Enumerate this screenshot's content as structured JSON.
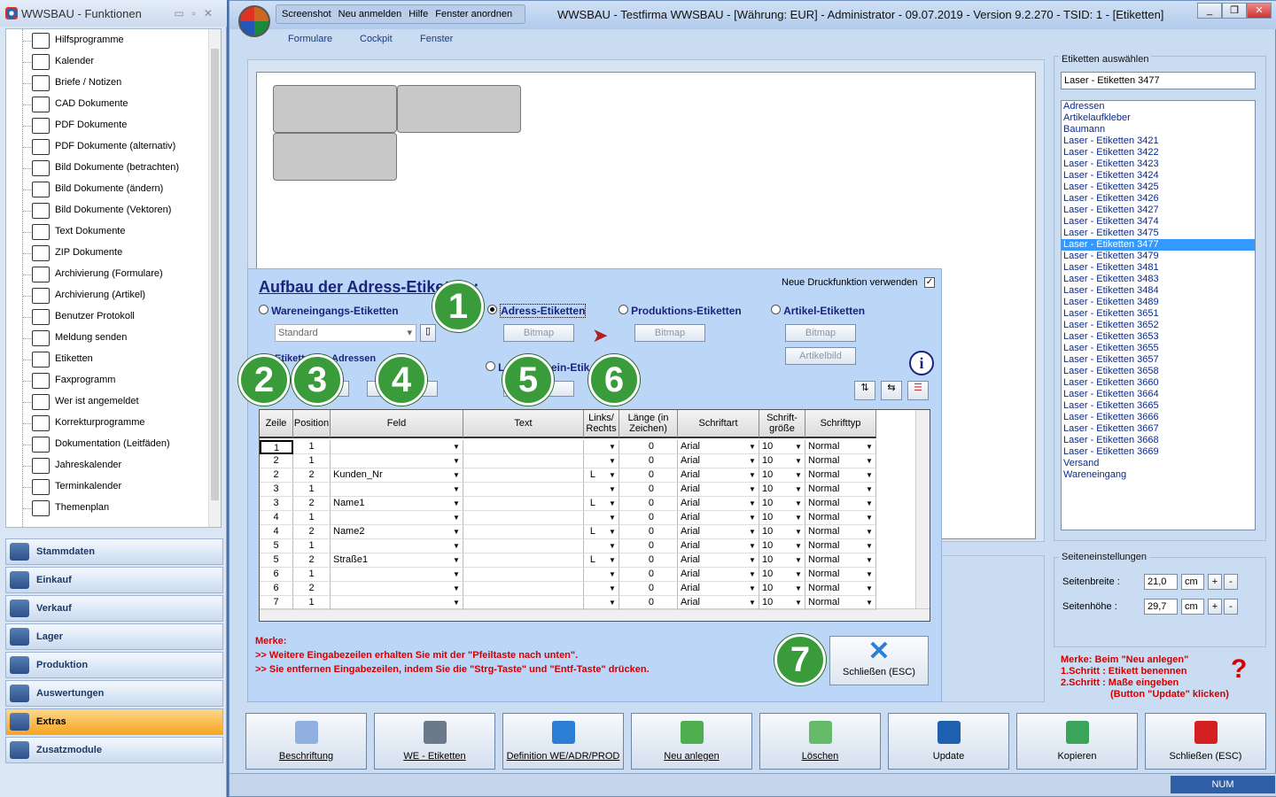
{
  "left_panel": {
    "title": "WWSBAU - Funktionen",
    "tree": [
      "Hilfsprogramme",
      "Kalender",
      "Briefe / Notizen",
      "CAD Dokumente",
      "PDF Dokumente",
      "PDF Dokumente (alternativ)",
      "Bild Dokumente (betrachten)",
      "Bild Dokumente (ändern)",
      "Bild Dokumente (Vektoren)",
      "Text Dokumente",
      "ZIP Dokumente",
      "Archivierung (Formulare)",
      "Archivierung (Artikel)",
      "Benutzer Protokoll",
      "Meldung senden",
      "Etiketten",
      "Faxprogramm",
      "Wer ist angemeldet",
      "Korrekturprogramme",
      "Dokumentation (Leitfäden)",
      "Jahreskalender",
      "Terminkalender",
      "Themenplan"
    ],
    "nav": [
      "Stammdaten",
      "Einkauf",
      "Verkauf",
      "Lager",
      "Produktion",
      "Auswertungen",
      "Extras",
      "Zusatzmodule"
    ],
    "active_nav": "Extras"
  },
  "window": {
    "quick": [
      "Screenshot",
      "Neu anmelden",
      "Hilfe",
      "Fenster anordnen"
    ],
    "title": "WWSBAU - Testfirma WWSBAU - [Währung: EUR] - Administrator - 09.07.2019 - Version 9.2.270 - TSID: 1 - [Etiketten]",
    "menu": [
      "Formulare",
      "Cockpit",
      "Fenster"
    ]
  },
  "right": {
    "group_title": "Etiketten auswählen",
    "selected": "Laser - Etiketten 3477",
    "list": [
      "Adressen",
      "Artikelaufkleber",
      "Baumann",
      "Laser - Etiketten 3421",
      "Laser - Etiketten 3422",
      "Laser - Etiketten 3423",
      "Laser - Etiketten 3424",
      "Laser - Etiketten 3425",
      "Laser - Etiketten 3426",
      "Laser - Etiketten 3427",
      "Laser - Etiketten 3474",
      "Laser - Etiketten 3475",
      "Laser - Etiketten 3477",
      "Laser - Etiketten 3479",
      "Laser - Etiketten 3481",
      "Laser - Etiketten 3483",
      "Laser - Etiketten 3484",
      "Laser - Etiketten 3489",
      "Laser - Etiketten 3651",
      "Laser - Etiketten 3652",
      "Laser - Etiketten 3653",
      "Laser - Etiketten 3655",
      "Laser - Etiketten 3657",
      "Laser - Etiketten 3658",
      "Laser - Etiketten 3660",
      "Laser - Etiketten 3664",
      "Laser - Etiketten 3665",
      "Laser - Etiketten 3666",
      "Laser - Etiketten 3667",
      "Laser - Etiketten 3668",
      "Laser - Etiketten 3669",
      "Versand",
      "Wareneingang"
    ],
    "highlight_index": 12,
    "page_group": "Seiteneinstellungen",
    "width_label": "Seitenbreite :",
    "width": "21,0",
    "height_label": "Seitenhöhe :",
    "height": "29,7",
    "unit": "cm",
    "plus": "+",
    "minus": "-",
    "note": [
      "Merke: Beim \"Neu anlegen\"",
      "1.Schritt : Etikett benennen",
      "2.Schritt : Maße eingeben",
      "(Button \"Update\" klicken)"
    ],
    "question": "?"
  },
  "dialog": {
    "heading": "Aufbau der Adress-Etiketten:",
    "new_print": "Neue Druckfunktion verwenden",
    "radios": [
      "Wareneingangs-Etiketten",
      "Adress-Etiketten",
      "Produktions-Etiketten",
      "Artikel-Etiketten"
    ],
    "standard": "Standard",
    "bitmap": "Bitmap",
    "artikelbild": "Artikelbild",
    "sub_label": "Etikett",
    "sub_label2": "Adressen",
    "radio5": "L",
    "radio5b": "ein-Etik",
    "info": "i",
    "columns": [
      "Zeile",
      "Position",
      "Feld",
      "Text",
      "Links/ Rechts",
      "Länge (in Zeichen)",
      "Schriftart",
      "Schrift- größe",
      "Schrifttyp"
    ],
    "rows": [
      [
        "1",
        "1",
        "",
        "",
        "",
        "0",
        "Arial",
        "10",
        "Normal"
      ],
      [
        "2",
        "1",
        "",
        "",
        "",
        "0",
        "Arial",
        "10",
        "Normal"
      ],
      [
        "2",
        "2",
        "Kunden_Nr",
        "",
        "L",
        "0",
        "Arial",
        "10",
        "Normal"
      ],
      [
        "3",
        "1",
        "",
        "",
        "",
        "0",
        "Arial",
        "10",
        "Normal"
      ],
      [
        "3",
        "2",
        "Name1",
        "",
        "L",
        "0",
        "Arial",
        "10",
        "Normal"
      ],
      [
        "4",
        "1",
        "",
        "",
        "",
        "0",
        "Arial",
        "10",
        "Normal"
      ],
      [
        "4",
        "2",
        "Name2",
        "",
        "L",
        "0",
        "Arial",
        "10",
        "Normal"
      ],
      [
        "5",
        "1",
        "",
        "",
        "",
        "0",
        "Arial",
        "10",
        "Normal"
      ],
      [
        "5",
        "2",
        "Straße1",
        "",
        "L",
        "0",
        "Arial",
        "10",
        "Normal"
      ],
      [
        "6",
        "1",
        "",
        "",
        "",
        "0",
        "Arial",
        "10",
        "Normal"
      ],
      [
        "6",
        "2",
        "",
        "",
        "",
        "0",
        "Arial",
        "10",
        "Normal"
      ],
      [
        "7",
        "1",
        "",
        "",
        "",
        "0",
        "Arial",
        "10",
        "Normal"
      ]
    ],
    "merke": [
      "Merke:",
      ">> Weitere Eingabezeilen erhalten Sie mit der \"Pfeiltaste nach unten\".",
      ">> Sie entfernen Eingabezeilen, indem Sie die \"Strg-Taste\" und \"Entf-Taste\" drücken."
    ],
    "close": "Schließen (ESC)",
    "markers": [
      "1",
      "2",
      "3",
      "4",
      "5",
      "6",
      "7"
    ]
  },
  "bottom": [
    "Beschriftung",
    "WE - Etiketten",
    "Definition WE/ADR/PROD",
    "Neu anlegen",
    "Löschen",
    "Update",
    "Kopieren",
    "Schließen (ESC)"
  ],
  "status": "NUM"
}
